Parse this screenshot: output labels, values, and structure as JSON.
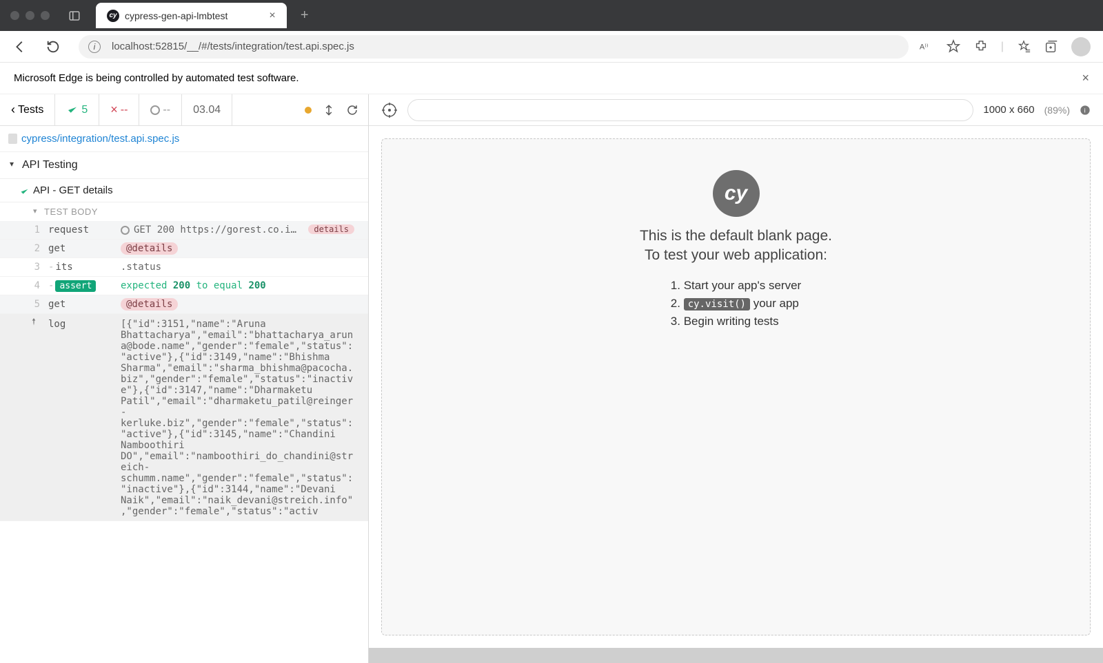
{
  "browser": {
    "tab_title": "cypress-gen-api-lmbtest",
    "url": "localhost:52815/__/#/tests/integration/test.api.spec.js",
    "notice": "Microsoft Edge is being controlled by automated test software."
  },
  "runner": {
    "tests_label": "Tests",
    "passed": "5",
    "failed": "--",
    "pending": "--",
    "duration": "03.04",
    "spec_path": "cypress/integration/test.api.spec.js",
    "suite": "API Testing",
    "test_title": "API - GET details",
    "body_label": "TEST BODY"
  },
  "commands": [
    {
      "num": "1",
      "name": "request",
      "msg": "GET 200 https://gorest.co.i…",
      "req": true,
      "detail": "details"
    },
    {
      "num": "2",
      "name": "get",
      "msg": "@details",
      "alias": true,
      "hl": true
    },
    {
      "num": "3",
      "name": "-its",
      "msg": ".status"
    },
    {
      "num": "4",
      "name": "assert",
      "assert": true,
      "msg_assert": {
        "pre": "expected ",
        "v1": "200",
        "mid": " to equal ",
        "v2": "200"
      }
    },
    {
      "num": "5",
      "name": "get",
      "msg": "@details",
      "alias": true,
      "hl": true
    }
  ],
  "log": {
    "name": "log",
    "msg": "[{\"id\":3151,\"name\":\"Aruna Bhattacharya\",\"email\":\"bhattacharya_aruna@bode.name\",\"gender\":\"female\",\"status\":\"active\"},{\"id\":3149,\"name\":\"Bhishma Sharma\",\"email\":\"sharma_bhishma@pacocha.biz\",\"gender\":\"female\",\"status\":\"inactive\"},{\"id\":3147,\"name\":\"Dharmaketu Patil\",\"email\":\"dharmaketu_patil@reinger-kerluke.biz\",\"gender\":\"female\",\"status\":\"active\"},{\"id\":3145,\"name\":\"Chandini Namboothiri DO\",\"email\":\"namboothiri_do_chandini@streich-schumm.name\",\"gender\":\"female\",\"status\":\"inactive\"},{\"id\":3144,\"name\":\"Devani Naik\",\"email\":\"naik_devani@streich.info\",\"gender\":\"female\",\"status\":\"activ"
  },
  "aut": {
    "heading1": "This is the default blank page.",
    "heading2": "To test your web application:",
    "steps": [
      "Start your app's server",
      "cy.visit()",
      " your app",
      "Begin writing tests"
    ],
    "dims": "1000 x 660",
    "pct": "(89%)"
  }
}
